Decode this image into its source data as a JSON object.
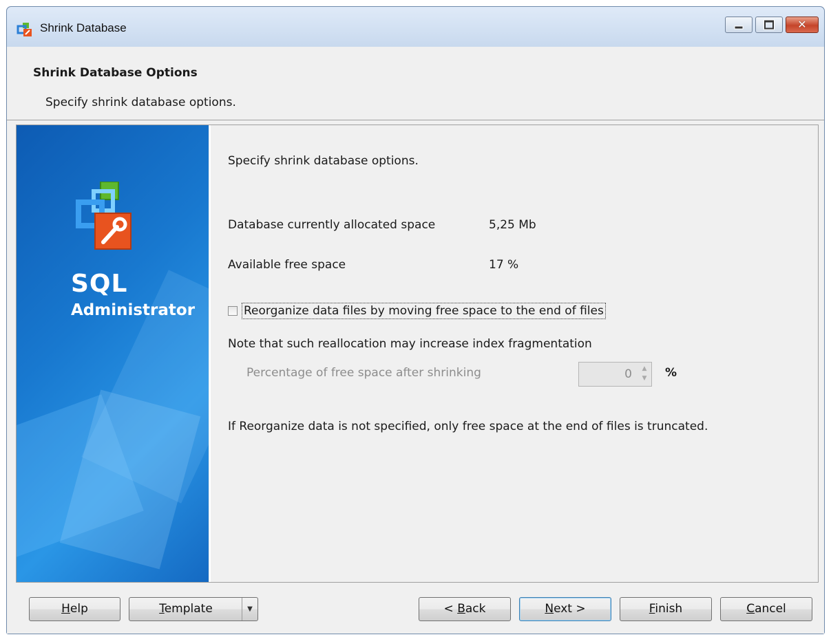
{
  "window": {
    "title": "Shrink Database",
    "icon": "sql-administrator-app-icon",
    "controls": {
      "minimize": "minimize-icon",
      "maximize": "maximize-icon",
      "close": "close-icon"
    }
  },
  "header": {
    "title": "Shrink Database Options",
    "subtitle": "Specify shrink database options."
  },
  "banner": {
    "line1": "SQL",
    "line2": "Administrator"
  },
  "content": {
    "intro": "Specify shrink database options.",
    "allocated_label": "Database currently allocated space",
    "allocated_value": "5,25 Mb",
    "free_label": "Available free space",
    "free_value": "17 %",
    "reorganize_label": "Reorganize data files by moving free space to the end of files",
    "reorganize_checked": false,
    "note": "Note that such reallocation may increase index fragmentation",
    "percentage_label": "Percentage of free space after shrinking",
    "percentage_value": "0",
    "percentage_unit": "%",
    "final_note": "If Reorganize data is not specified, only free space at the end of files is truncated."
  },
  "footer": {
    "help": {
      "mnemonic": "H",
      "rest": "elp"
    },
    "template": {
      "mnemonic": "T",
      "rest": "emplate"
    },
    "back": {
      "prefix": "< ",
      "mnemonic": "B",
      "rest": "ack"
    },
    "next": {
      "mnemonic": "N",
      "rest": "ext >"
    },
    "finish": {
      "mnemonic": "F",
      "rest": "inish"
    },
    "cancel": {
      "mnemonic": "C",
      "rest": "ancel"
    }
  },
  "colors": {
    "banner_blue": "#1878cf",
    "close_red": "#c5452a",
    "logo_orange": "#e8531f",
    "logo_green": "#5fb82e"
  }
}
